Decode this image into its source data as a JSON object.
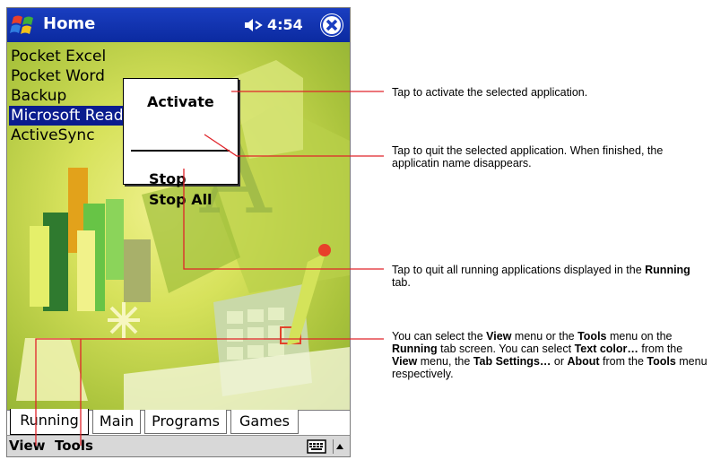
{
  "titlebar": {
    "title": "Home",
    "time": "4:54"
  },
  "running_apps": [
    {
      "label": "Pocket Excel",
      "selected": false
    },
    {
      "label": "Pocket Word",
      "selected": false
    },
    {
      "label": "Backup",
      "selected": false
    },
    {
      "label": "Microsoft Reader",
      "selected": true
    },
    {
      "label": "ActiveSync",
      "selected": false
    }
  ],
  "context_menu": {
    "activate": "Activate",
    "stop": "Stop",
    "stop_all": "Stop All"
  },
  "tabs": [
    {
      "label": "Running",
      "active": true
    },
    {
      "label": "Main",
      "active": false
    },
    {
      "label": "Programs",
      "active": false
    },
    {
      "label": "Games",
      "active": false
    }
  ],
  "commandbar": {
    "view": "View",
    "tools": "Tools"
  },
  "annotations": {
    "activate": "Tap to activate the selected application.",
    "stop": "Tap to quit the selected application. When finished, the applicatin name disappears.",
    "stop_all": {
      "t1": "Tap to quit all running applications displayed in the ",
      "b1": "Running",
      "t2": " tab."
    },
    "menus": {
      "t1": "You can select the ",
      "b1": "View",
      "t2": " menu or the ",
      "b2": "Tools",
      "t3": " menu on the ",
      "b3": "Running",
      "t4": " tab screen. You can select ",
      "b4": "Text color…",
      "t5": " from the ",
      "b5": "View",
      "t6": " menu, the ",
      "b6": "Tab Settings…",
      "t7": " or ",
      "b7": "About",
      "t8": " from the ",
      "b8": "Tools",
      "t9": " menu respectively."
    }
  },
  "colors": {
    "titlebar": "#1a3ec0",
    "selection": "#0a1c8e",
    "callout_line": "#e0242a"
  }
}
